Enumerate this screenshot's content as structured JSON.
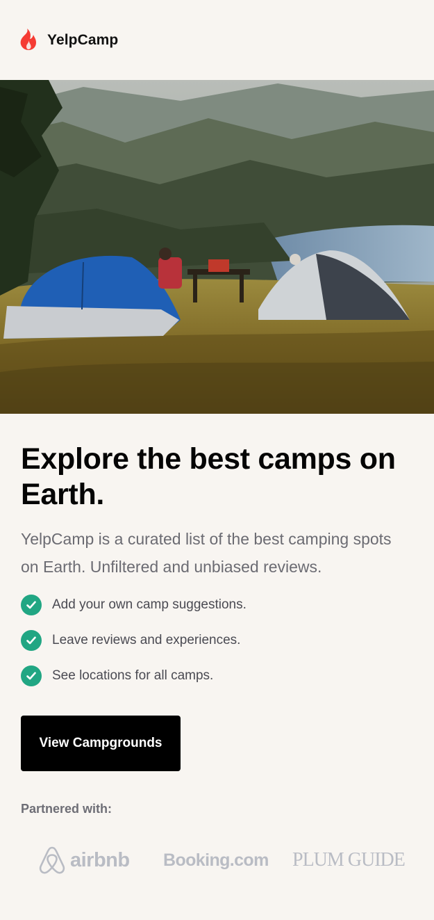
{
  "brand": {
    "name": "YelpCamp",
    "logo_icon": "flame-icon",
    "logo_color": "#f53b33"
  },
  "hero": {
    "image": "camping-tents-mountain-lake-photo"
  },
  "main": {
    "headline": "Explore the best camps on Earth.",
    "lead": "YelpCamp is a curated list of the best camping spots on Earth. Unfiltered and unbiased reviews.",
    "features": [
      "Add your own camp suggestions.",
      "Leave reviews and experiences.",
      "See locations for all camps."
    ],
    "check_icon": "check-circle-icon",
    "accent_color": "#21a683",
    "cta_label": "View Campgrounds"
  },
  "partners": {
    "label": "Partnered with:",
    "logos": [
      {
        "name": "airbnb",
        "icon": "airbnb-icon"
      },
      {
        "name": "Booking.com"
      },
      {
        "name": "PLUM GUIDE"
      }
    ]
  }
}
